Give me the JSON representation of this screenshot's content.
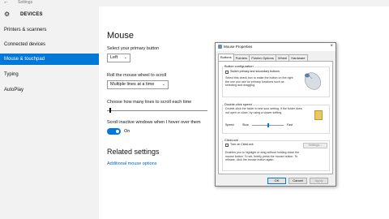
{
  "window": {
    "title": "Settings",
    "back_glyph": "←"
  },
  "sidebar": {
    "icon": "gear-icon",
    "heading": "DEVICES",
    "items": [
      {
        "label": "Printers & scanners",
        "selected": false
      },
      {
        "label": "Connected devices",
        "selected": false
      },
      {
        "label": "Mouse & touchpad",
        "selected": true
      },
      {
        "label": "Typing",
        "selected": false
      },
      {
        "label": "AutoPlay",
        "selected": false
      }
    ]
  },
  "main": {
    "title": "Mouse",
    "primary_button": {
      "label": "Select your primary button",
      "value": "Left"
    },
    "wheel": {
      "label": "Roll the mouse wheel to scroll",
      "value": "Multiple lines at a time"
    },
    "lines": {
      "label": "Choose how many lines to scroll each time",
      "level": 0.03
    },
    "inactive": {
      "label": "Scroll inactive windows when I hover over them",
      "state": "On",
      "on": true
    },
    "related": {
      "title": "Related settings",
      "link": "Additional mouse options"
    }
  },
  "dialog": {
    "title": "Mouse Properties",
    "close_glyph": "×",
    "tabs": [
      "Buttons",
      "Pointers",
      "Pointer Options",
      "Wheel",
      "Hardware"
    ],
    "active_tab": 0,
    "button_config": {
      "group_label": "Button configuration",
      "checkbox_label": "Switch primary and secondary buttons",
      "description": "Select this check box to make the button on the right the one you use for primary functions such as selecting and dragging."
    },
    "double_click": {
      "group_label": "Double-click speed",
      "description": "Double-click the folder to test your setting. If the folder does not open or close, try using a slower setting.",
      "speed_label": "Speed:",
      "slow_label": "Slow",
      "fast_label": "Fast",
      "speed_level": 0.5
    },
    "clicklock": {
      "group_label": "ClickLock",
      "checkbox_label": "Turn on ClickLock",
      "settings_label": "Settings...",
      "description": "Enables you to highlight or drag without holding down the mouse button. To set, briefly press the mouse button. To release, click the mouse button again."
    },
    "buttons": {
      "ok": "OK",
      "cancel": "Cancel",
      "apply": "Apply"
    }
  },
  "colors": {
    "accent": "#0078d7",
    "sidebar_bg": "#f2f2f2",
    "link": "#0067c0"
  }
}
